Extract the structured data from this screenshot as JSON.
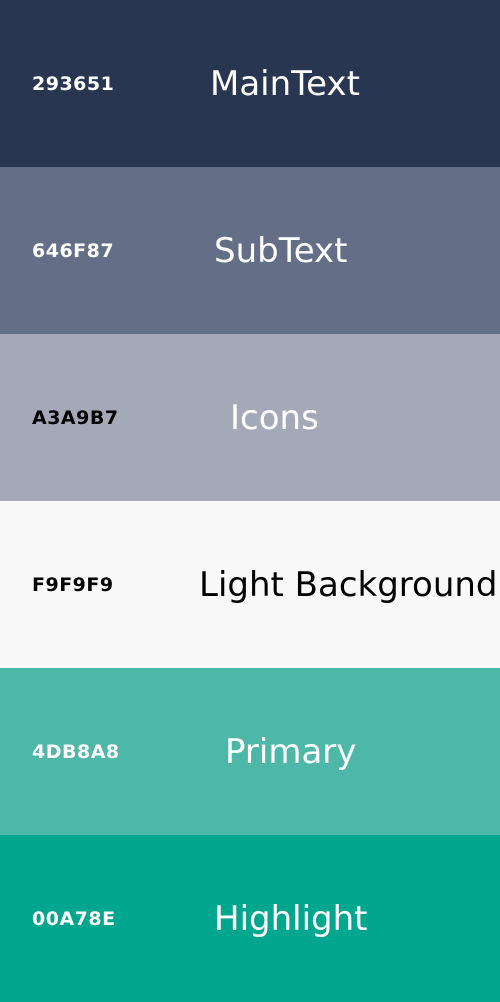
{
  "swatches": [
    {
      "hex": "293651",
      "name": "MainText",
      "color": "#293651",
      "text_color": "#ffffff"
    },
    {
      "hex": "646F87",
      "name": "SubText",
      "color": "#646F87",
      "text_color": "#ffffff"
    },
    {
      "hex": "A3A9B7",
      "name": "Icons",
      "color": "#A3A9B7",
      "text_color": "#000000",
      "name_color": "#ffffff"
    },
    {
      "hex": "F9F9F9",
      "name": "Light Background",
      "color": "#F9F9F9",
      "text_color": "#000000"
    },
    {
      "hex": "4DB8A8",
      "name": "Primary",
      "color": "#4DB8A8",
      "text_color": "#ffffff"
    },
    {
      "hex": "00A78E",
      "name": "Highlight",
      "color": "#00A78E",
      "text_color": "#ffffff"
    }
  ]
}
